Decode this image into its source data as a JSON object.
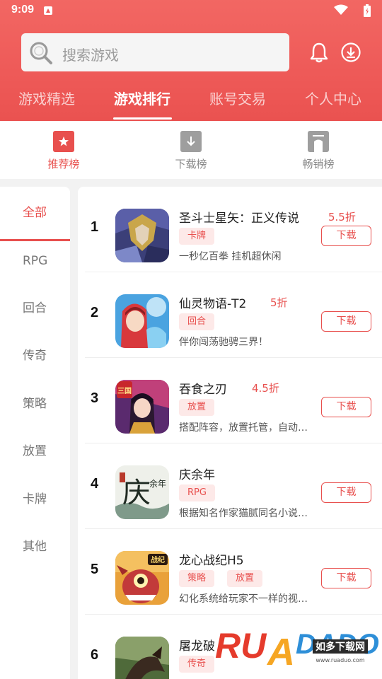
{
  "status": {
    "time": "9:09"
  },
  "search": {
    "placeholder": "搜索游戏"
  },
  "top_tabs": [
    {
      "label": "游戏精选",
      "active": false
    },
    {
      "label": "游戏排行",
      "active": true
    },
    {
      "label": "账号交易",
      "active": false
    },
    {
      "label": "个人中心",
      "active": false
    }
  ],
  "sub_tabs": [
    {
      "label": "推荐榜",
      "icon": "star-icon",
      "active": true
    },
    {
      "label": "下载榜",
      "icon": "download-arrow-icon",
      "active": false
    },
    {
      "label": "畅销榜",
      "icon": "bestseller-icon",
      "active": false
    }
  ],
  "sidebar": {
    "items": [
      {
        "label": "全部",
        "active": true
      },
      {
        "label": "RPG",
        "active": false
      },
      {
        "label": "回合",
        "active": false
      },
      {
        "label": "传奇",
        "active": false
      },
      {
        "label": "策略",
        "active": false
      },
      {
        "label": "放置",
        "active": false
      },
      {
        "label": "卡牌",
        "active": false
      },
      {
        "label": "其他",
        "active": false
      }
    ]
  },
  "games": [
    {
      "rank": "1",
      "name": "圣斗士星矢：正义传说",
      "discount": "5.5折",
      "tags": [
        "卡牌"
      ],
      "desc": "一秒亿百拳 挂机超休闲",
      "button": "下载"
    },
    {
      "rank": "2",
      "name": "仙灵物语-T2",
      "discount": "5折",
      "tags": [
        "回合"
      ],
      "desc": "伴你闯荡驰骋三界！",
      "button": "下载"
    },
    {
      "rank": "3",
      "name": "吞食之刃",
      "discount": "4.5折",
      "tags": [
        "放置"
      ],
      "desc": "搭配阵容，放置托管，自动…",
      "button": "下载"
    },
    {
      "rank": "4",
      "name": "庆余年",
      "discount": "",
      "tags": [
        "RPG"
      ],
      "desc": "根据知名作家猫腻同名小说…",
      "button": "下载"
    },
    {
      "rank": "5",
      "name": "龙心战纪H5",
      "discount": "",
      "tags": [
        "策略",
        "放置"
      ],
      "desc": "幻化系统给玩家不一样的视…",
      "button": "下载"
    },
    {
      "rank": "6",
      "name": "屠龙破",
      "discount": "",
      "tags": [
        "传奇"
      ],
      "desc": "",
      "button": ""
    }
  ],
  "icon_text": {
    "game3_badge": "三国",
    "game4_char1": "庆",
    "game4_char2": "余年",
    "game5_badge": "战纪"
  },
  "watermark": {
    "brand": "RUANDADO",
    "cn": "如多下载网",
    "url": "www.ruaduo.com"
  },
  "colors": {
    "accent": "#e8504e",
    "header": "#ee5a58",
    "tag_bg": "#fde9e8"
  }
}
